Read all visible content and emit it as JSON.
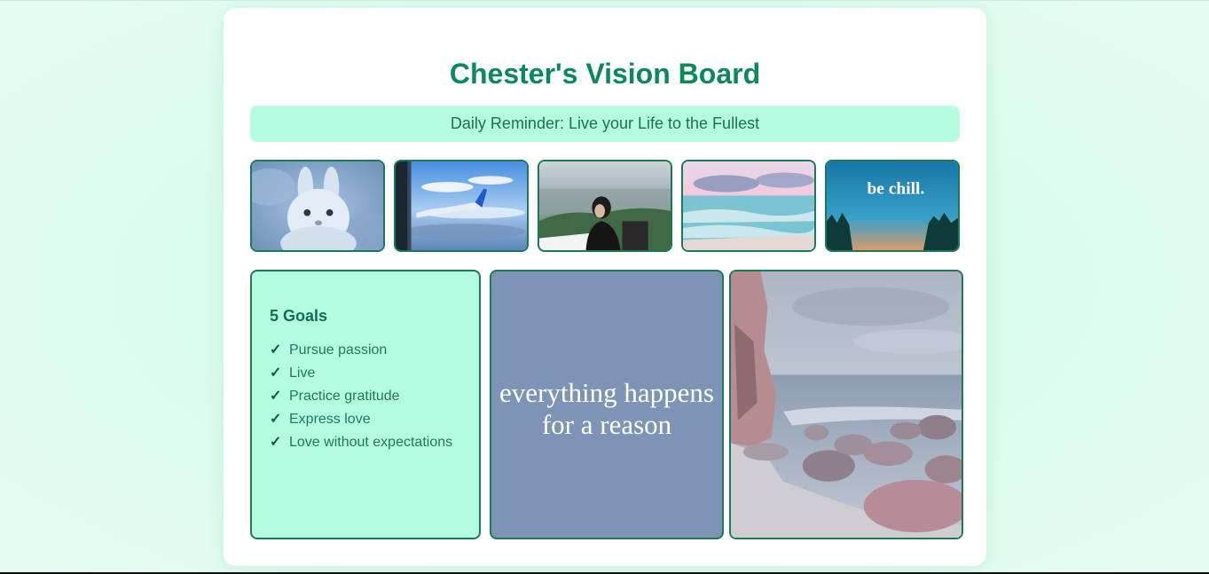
{
  "title": "Chester's Vision Board",
  "reminder": "Daily Reminder: Live your Life to the Fullest",
  "photos": [
    {
      "name": "bunny-photo"
    },
    {
      "name": "airplane-wing-photo"
    },
    {
      "name": "woman-overlook-photo"
    },
    {
      "name": "ocean-sunset-photo"
    },
    {
      "name": "be-chill-photo",
      "caption": "be chill."
    }
  ],
  "goals": {
    "heading": "5 Goals",
    "items": [
      "Pursue passion",
      "Live",
      "Practice gratitude",
      "Express love",
      "Love without expectations"
    ]
  },
  "quote": {
    "text": "everything happens\nfor a reason"
  },
  "colors": {
    "accent": "#0b8a59",
    "mint": "#b5fde0",
    "border": "#197a55",
    "quote_bg": "#7e94b6"
  }
}
